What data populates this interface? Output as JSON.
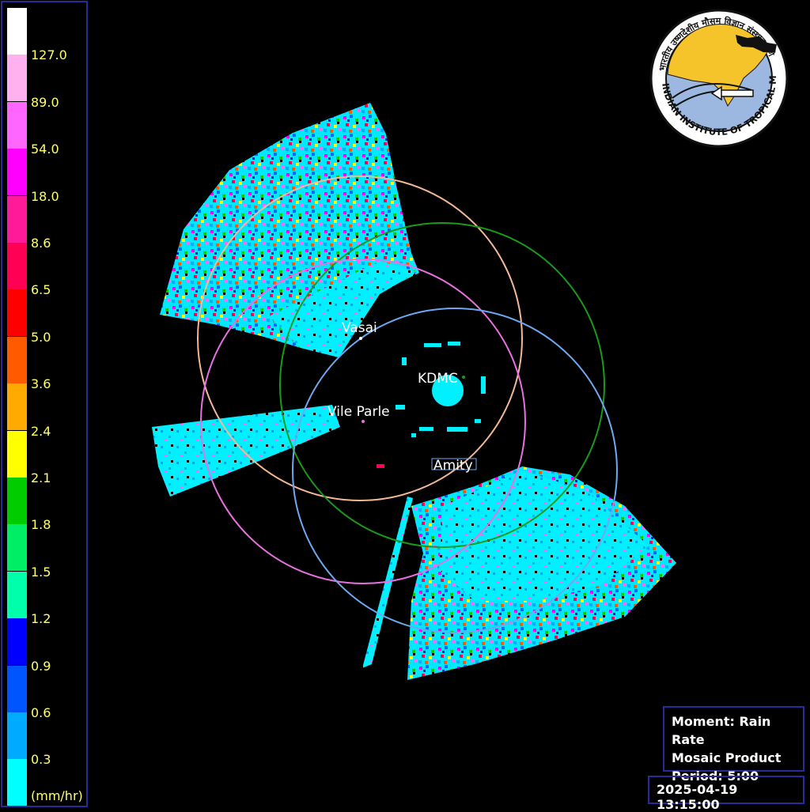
{
  "legend": {
    "colors": [
      "#ffffff",
      "#ffb0ee",
      "#ff66ff",
      "#ff00ff",
      "#ff1a99",
      "#ff0055",
      "#ff0000",
      "#ff5a00",
      "#ffaa00",
      "#ffff00",
      "#00cc00",
      "#00ee66",
      "#00ffaa",
      "#0000ff",
      "#0055ff",
      "#00aaff",
      "#00ffff"
    ],
    "ticks": [
      "127.0",
      "89.0",
      "54.0",
      "18.0",
      "8.6",
      "6.5",
      "5.0",
      "3.6",
      "2.4",
      "2.1",
      "1.8",
      "1.5",
      "1.2",
      "0.9",
      "0.6",
      "0.3"
    ],
    "unit": "(mm/hr)"
  },
  "places": {
    "vasai": "Vasai",
    "kdmc": "KDMC",
    "vile_parle": "Vile Parle",
    "amity": "Amity"
  },
  "info": {
    "moment": "Moment: Rain Rate",
    "product": "Mosaic Product",
    "period": "Period: 5:00"
  },
  "timestamp": "2025-04-19 13:15:00",
  "logo": {
    "org_text": "INDIAN INSTITUTE OF TROPICAL METEOROLOGY PUNE",
    "hindi_text": "भारतीय उष्णदेशीय मौसम विज्ञान संस्थान पुणे"
  },
  "ring_colors": {
    "vasai": "#f5b896",
    "kdmc": "#1a9a1a",
    "vile_parle": "#e870e0",
    "amity": "#6fa8f0"
  }
}
